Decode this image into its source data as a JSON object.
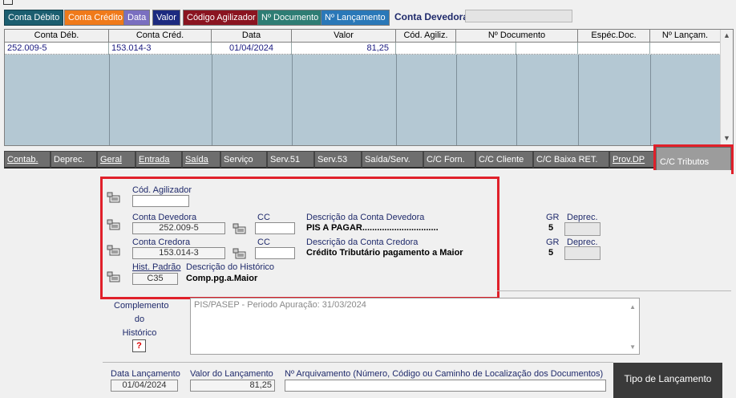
{
  "top_tabs": [
    {
      "label": "Conta Débito",
      "accesskey_index": 9,
      "bg": "#1b5e70",
      "color": "#ffffff"
    },
    {
      "label": "Conta Crédito",
      "bg": "#f07a1a",
      "color": "#ffffff"
    },
    {
      "label": "Data",
      "bg": "#7a6fc0",
      "color": "#ffffff"
    },
    {
      "label": "Valor",
      "bg": "#1c2a80",
      "color": "#ffffff"
    },
    {
      "label": "Código Agilizador",
      "bg": "#8a1420",
      "color": "#ffffff"
    },
    {
      "label": "Nº Documento",
      "bg": "#2e7d74",
      "color": "#ffffff"
    },
    {
      "label": "Nº Lançamento",
      "bg": "#2a78b8",
      "color": "#ffffff"
    }
  ],
  "conta_devedora_label": "Conta Devedora",
  "grid": {
    "columns": [
      "Conta Déb.",
      "Conta Créd.",
      "Data",
      "Valor",
      "Cód. Agiliz.",
      "Nº Documento",
      "",
      "Espéc.Doc.",
      "Nº Lançam."
    ],
    "rows": [
      [
        "252.009-5",
        "153.014-3",
        "01/04/2024",
        "81,25",
        "",
        "",
        "",
        "",
        ""
      ]
    ]
  },
  "tabs2": [
    "Contab.",
    "Deprec.",
    "Geral",
    "Entrada",
    "Saída",
    "Serviço",
    "Serv.51",
    "Serv.53",
    "Saída/Serv.",
    "C/C Forn.",
    "C/C Cliente",
    "C/C Baixa RET.",
    "Prov.DP",
    "C/C Tributos"
  ],
  "form": {
    "cod_agilizador_label": "Cód. Agilizador",
    "cod_agilizador_value": "",
    "conta_devedora_label": "Conta Devedora",
    "conta_devedora_value": "252.009-5",
    "cc_label": "CC",
    "desc_devedora_label": "Descrição da Conta Devedora",
    "desc_devedora_value": "PIS A PAGAR...............................",
    "conta_credora_label": "Conta Credora",
    "conta_credora_value": "153.014-3",
    "desc_credora_label": "Descrição da Conta Credora",
    "desc_credora_value": "Crédito Tributário pagamento a Maior",
    "gr_label": "GR",
    "deprec_label": "Deprec.",
    "gr_dev_value": "5",
    "gr_cred_value": "5",
    "hist_padrao_label": "Hist. Padrão",
    "hist_padrao_value": "C35",
    "desc_historico_label": "Descrição do Histórico",
    "desc_historico_value": "Comp.pg.a.Maior",
    "complemento_label_1": "Complemento",
    "complemento_label_2": "do",
    "complemento_label_3": "Histórico",
    "complemento_value": "PIS/PASEP - Periodo Apuração: 31/03/2024",
    "help_button": "?",
    "data_lancamento_label": "Data Lançamento",
    "data_lancamento_value": "01/04/2024",
    "valor_lancamento_label": "Valor do Lançamento",
    "valor_lancamento_value": "81,25",
    "arquivamento_label": "Nº Arquivamento (Número, Código ou Caminho de Localização dos Documentos)",
    "arquivamento_value": "",
    "tipo_lancamento_button": "Tipo de Lançamento"
  },
  "highlight_color": "#e0202a",
  "grid_bg_color": "#b4c8d3"
}
